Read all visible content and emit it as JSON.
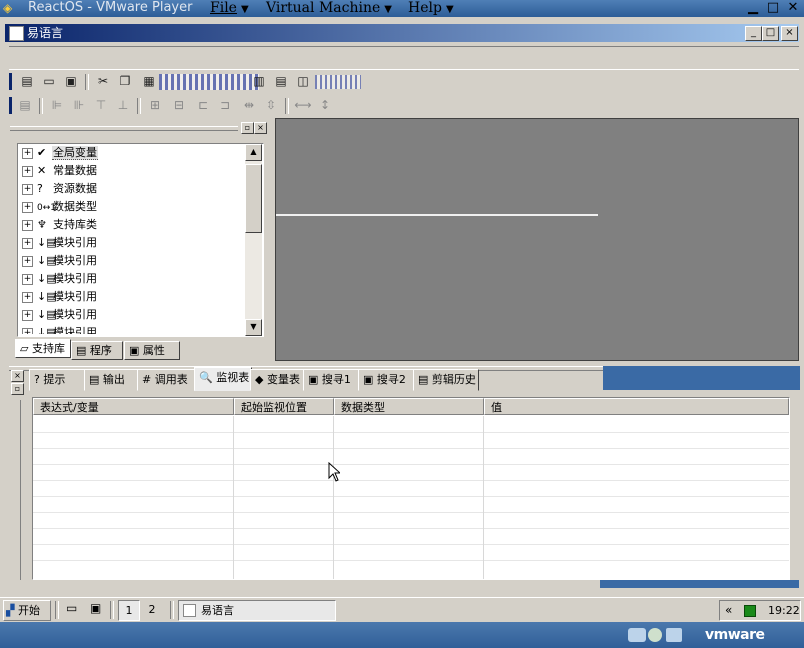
{
  "vm_window": {
    "title": "ReactOS - VMware Player",
    "menus": [
      "File",
      "Virtual Machine",
      "Help"
    ],
    "brand": "vmware"
  },
  "app_window": {
    "title": "易语言",
    "controls": {
      "minimize": "_",
      "maximize": "□",
      "close": "×"
    }
  },
  "left_panel": {
    "tree_items": [
      {
        "icon": "check-icon",
        "glyph": "✔",
        "label": "全局变量",
        "selected": true
      },
      {
        "icon": "compare-icon",
        "glyph": "✕",
        "label": "常量数据"
      },
      {
        "icon": "question-icon",
        "glyph": "?",
        "label": "资源数据"
      },
      {
        "icon": "binary-icon",
        "glyph": "0↔1",
        "label": "数据类型"
      },
      {
        "icon": "lib-icon",
        "glyph": "♆",
        "label": "支持库类"
      },
      {
        "icon": "module-icon",
        "glyph": "↓▤",
        "label": "模块引用"
      },
      {
        "icon": "module-icon",
        "glyph": "↓▤",
        "label": "模块引用"
      },
      {
        "icon": "module-icon",
        "glyph": "↓▤",
        "label": "模块引用"
      },
      {
        "icon": "module-icon",
        "glyph": "↓▤",
        "label": "模块引用"
      },
      {
        "icon": "module-icon",
        "glyph": "↓▤",
        "label": "模块引用"
      },
      {
        "icon": "module-icon",
        "glyph": "↓▤",
        "label": "模块引用"
      }
    ],
    "tabs": [
      {
        "label": "支持库",
        "active": true
      },
      {
        "label": "程序"
      },
      {
        "label": "属性"
      }
    ]
  },
  "bottom_panel": {
    "tabs": [
      {
        "label": "提示",
        "glyph": "?"
      },
      {
        "label": "输出",
        "glyph": "▤"
      },
      {
        "label": "调用表",
        "glyph": "#"
      },
      {
        "label": "监视表",
        "glyph": "🔍",
        "active": true
      },
      {
        "label": "变量表",
        "glyph": "◆"
      },
      {
        "label": "搜寻1",
        "glyph": "▣"
      },
      {
        "label": "搜寻2",
        "glyph": "▣"
      },
      {
        "label": "剪辑历史",
        "glyph": "▤"
      }
    ],
    "columns": [
      "表达式/变量",
      "起始监视位置",
      "数据类型",
      "值"
    ]
  },
  "taskbar": {
    "start_label": "开始",
    "workspaces": [
      "1",
      "2"
    ],
    "task_label": "易语言",
    "clock": "19:22",
    "tray_arrow": "«"
  },
  "colors": {
    "window_face": "#d4d0c8",
    "title_active": "#0a246a",
    "workspace": "#808080",
    "vm_blue": "#3a6aa5"
  }
}
